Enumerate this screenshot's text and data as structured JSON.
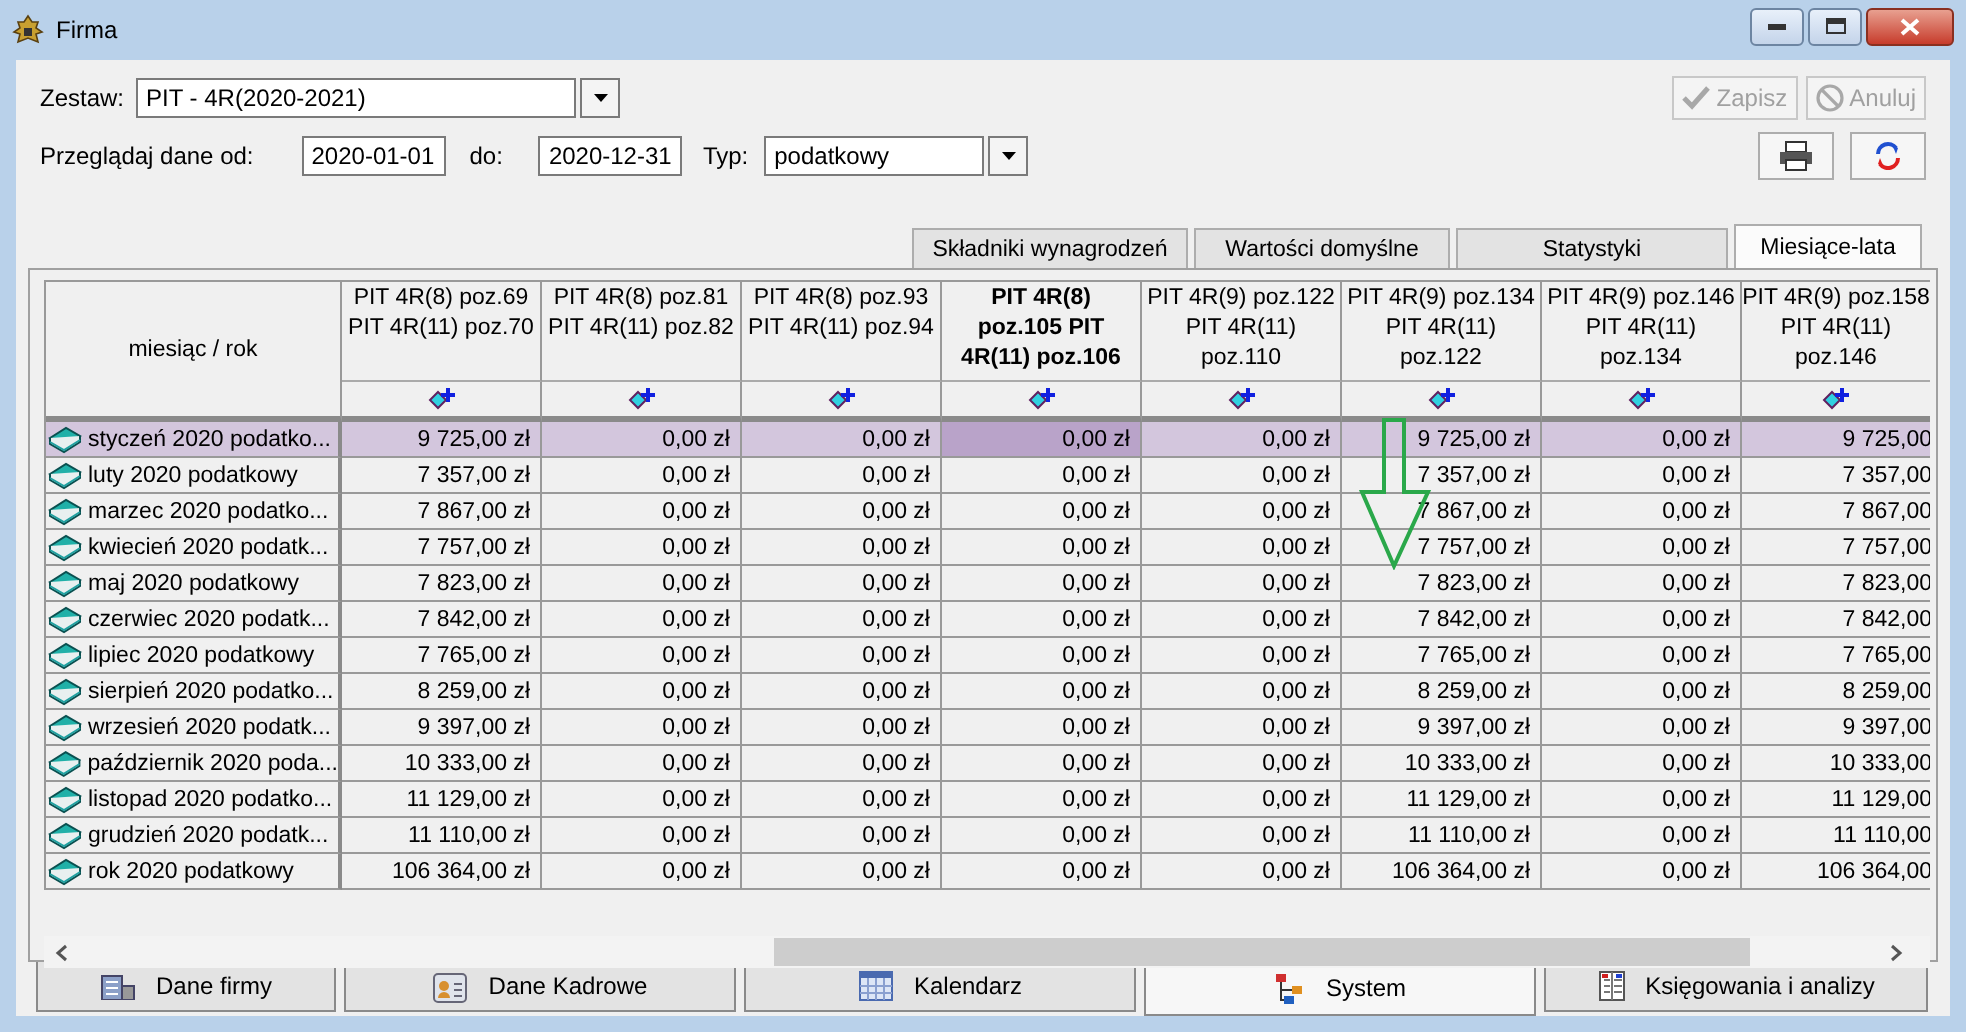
{
  "window": {
    "title": "Firma"
  },
  "toolbar": {
    "set_label": "Zestaw:",
    "set_value": "PIT - 4R(2020-2021)",
    "save_button": {
      "label": "Zapisz",
      "disabled": true
    },
    "cancel_button": {
      "label": "Anuluj",
      "disabled": true
    },
    "from_label": "Przeglądaj dane od:",
    "from_value": "2020-01-01",
    "to_label": "do:",
    "to_value": "2020-12-31",
    "type_label": "Typ:",
    "type_value": "podatkowy"
  },
  "tabs": [
    {
      "label": "Składniki wynagrodzeń",
      "selected": false
    },
    {
      "label": "Wartości domyślne",
      "selected": false
    },
    {
      "label": "Statystyki",
      "selected": false
    },
    {
      "label": "Miesiące-lata",
      "selected": true
    }
  ],
  "table": {
    "corner": "miesiąc / rok",
    "columns": [
      {
        "label": "PIT 4R(8) poz.69\nPIT 4R(11) poz.70",
        "selected": false
      },
      {
        "label": "PIT 4R(8) poz.81\nPIT 4R(11) poz.82",
        "selected": false
      },
      {
        "label": "PIT 4R(8) poz.93\nPIT 4R(11) poz.94",
        "selected": false
      },
      {
        "label": "PIT 4R(8)\npoz.105 PIT\n4R(11) poz.106",
        "selected": true
      },
      {
        "label": "PIT 4R(9) poz.122\nPIT 4R(11)\npoz.110",
        "selected": false
      },
      {
        "label": "PIT 4R(9) poz.134\nPIT 4R(11)\npoz.122",
        "selected": false
      },
      {
        "label": "PIT 4R(9) poz.146\nPIT 4R(11)\npoz.134",
        "selected": false
      },
      {
        "label": "PIT 4R(9) poz.158\nPIT 4R(11)\npoz.146",
        "selected": false
      }
    ],
    "rows": [
      {
        "label": "styczeń 2020 podatko...",
        "selected": true,
        "cells": [
          "9 725,00 zł",
          "0,00 zł",
          "0,00 zł",
          "0,00 zł",
          "0,00 zł",
          "9 725,00 zł",
          "0,00 zł",
          "9 725,00"
        ]
      },
      {
        "label": "luty 2020 podatkowy",
        "selected": false,
        "cells": [
          "7 357,00 zł",
          "0,00 zł",
          "0,00 zł",
          "0,00 zł",
          "0,00 zł",
          "7 357,00 zł",
          "0,00 zł",
          "7 357,00"
        ]
      },
      {
        "label": "marzec 2020 podatko...",
        "selected": false,
        "cells": [
          "7 867,00 zł",
          "0,00 zł",
          "0,00 zł",
          "0,00 zł",
          "0,00 zł",
          "7 867,00 zł",
          "0,00 zł",
          "7 867,00"
        ]
      },
      {
        "label": "kwiecień 2020 podatk...",
        "selected": false,
        "cells": [
          "7 757,00 zł",
          "0,00 zł",
          "0,00 zł",
          "0,00 zł",
          "0,00 zł",
          "7 757,00 zł",
          "0,00 zł",
          "7 757,00"
        ]
      },
      {
        "label": "maj 2020 podatkowy",
        "selected": false,
        "cells": [
          "7 823,00 zł",
          "0,00 zł",
          "0,00 zł",
          "0,00 zł",
          "0,00 zł",
          "7 823,00 zł",
          "0,00 zł",
          "7 823,00"
        ]
      },
      {
        "label": "czerwiec 2020 podatk...",
        "selected": false,
        "cells": [
          "7 842,00 zł",
          "0,00 zł",
          "0,00 zł",
          "0,00 zł",
          "0,00 zł",
          "7 842,00 zł",
          "0,00 zł",
          "7 842,00"
        ]
      },
      {
        "label": "lipiec 2020 podatkowy",
        "selected": false,
        "cells": [
          "7 765,00 zł",
          "0,00 zł",
          "0,00 zł",
          "0,00 zł",
          "0,00 zł",
          "7 765,00 zł",
          "0,00 zł",
          "7 765,00"
        ]
      },
      {
        "label": "sierpień 2020 podatko...",
        "selected": false,
        "cells": [
          "8 259,00 zł",
          "0,00 zł",
          "0,00 zł",
          "0,00 zł",
          "0,00 zł",
          "8 259,00 zł",
          "0,00 zł",
          "8 259,00"
        ]
      },
      {
        "label": "wrzesień 2020 podatk...",
        "selected": false,
        "cells": [
          "9 397,00 zł",
          "0,00 zł",
          "0,00 zł",
          "0,00 zł",
          "0,00 zł",
          "9 397,00 zł",
          "0,00 zł",
          "9 397,00"
        ]
      },
      {
        "label": "październik 2020 poda...",
        "selected": false,
        "cells": [
          "10 333,00 zł",
          "0,00 zł",
          "0,00 zł",
          "0,00 zł",
          "0,00 zł",
          "10 333,00 zł",
          "0,00 zł",
          "10 333,00"
        ]
      },
      {
        "label": "listopad 2020 podatko...",
        "selected": false,
        "cells": [
          "11 129,00 zł",
          "0,00 zł",
          "0,00 zł",
          "0,00 zł",
          "0,00 zł",
          "11 129,00 zł",
          "0,00 zł",
          "11 129,00"
        ]
      },
      {
        "label": "grudzień 2020 podatk...",
        "selected": false,
        "cells": [
          "11 110,00 zł",
          "0,00 zł",
          "0,00 zł",
          "0,00 zł",
          "0,00 zł",
          "11 110,00 zł",
          "0,00 zł",
          "11 110,00"
        ]
      },
      {
        "label": "rok 2020 podatkowy",
        "selected": false,
        "cells": [
          "106 364,00 zł",
          "0,00 zł",
          "0,00 zł",
          "0,00 zł",
          "0,00 zł",
          "106 364,00 zł",
          "0,00 zł",
          "106 364,00"
        ]
      }
    ]
  },
  "bottom_tabs": [
    {
      "label": "Dane firmy",
      "selected": false
    },
    {
      "label": "Dane Kadrowe",
      "selected": false
    },
    {
      "label": "Kalendarz",
      "selected": false
    },
    {
      "label": "System",
      "selected": true
    },
    {
      "label": "Księgowania i analizy",
      "selected": false
    }
  ]
}
